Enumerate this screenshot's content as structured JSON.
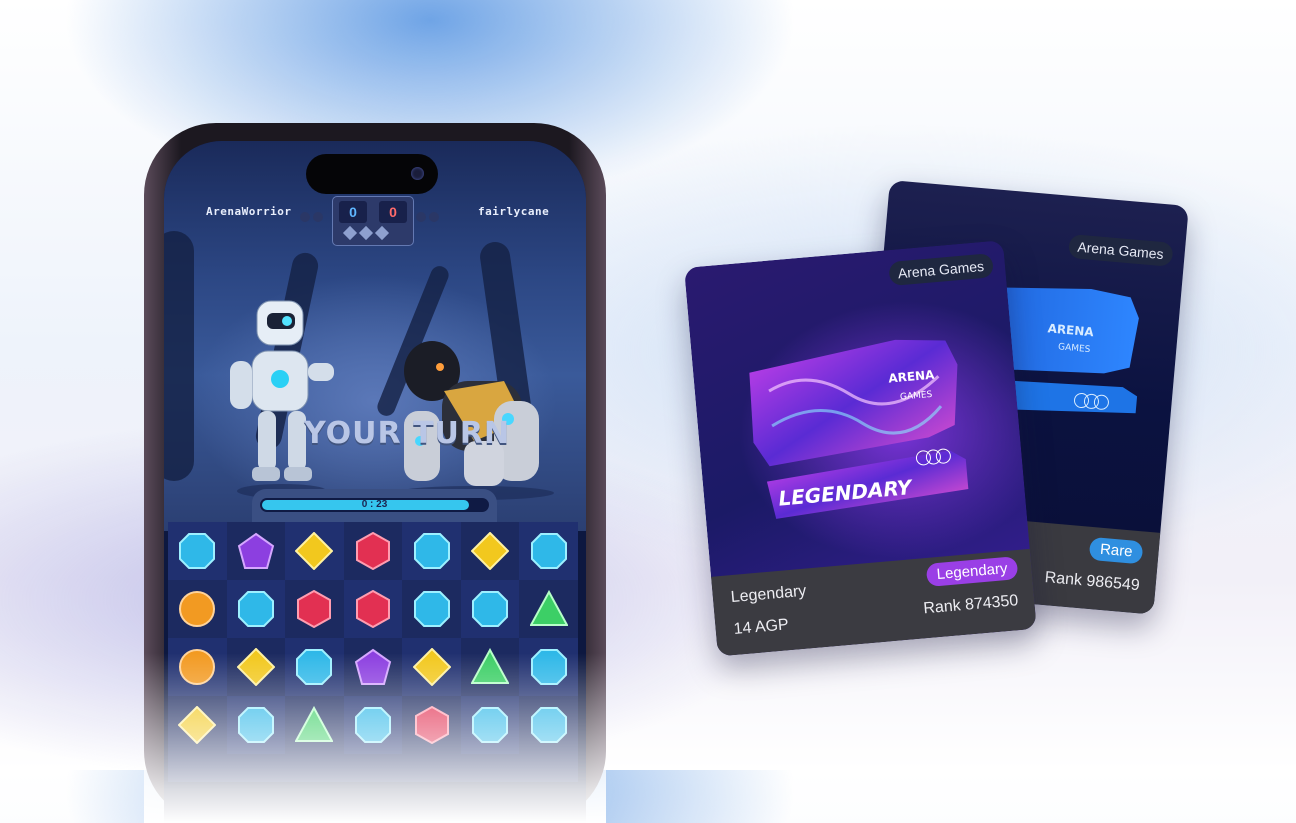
{
  "game": {
    "player_left": "ArenaWorrior",
    "player_right": "fairlycane",
    "score_left": "0",
    "score_right": "0",
    "turn_text": "YOUR TURN",
    "timer": "0 : 23",
    "timer_progress": 0.92,
    "colors": {
      "score_left": "#5fb6ff",
      "score_right": "#ff6b6b",
      "timer_fill": "#36c6ee"
    },
    "board": [
      [
        "blue",
        "purple",
        "yellow",
        "red",
        "blue",
        "yellow",
        "blue"
      ],
      [
        "orange",
        "blue",
        "red",
        "red",
        "blue",
        "blue",
        "green"
      ],
      [
        "orange",
        "yellow",
        "blue",
        "purple",
        "yellow",
        "green",
        "blue"
      ],
      [
        "yellow",
        "blue",
        "green",
        "blue",
        "red",
        "blue",
        "blue"
      ]
    ]
  },
  "card_back": {
    "brand": "Arena Games",
    "rarity_pill": "Rare",
    "rank": "Rank 986549",
    "pill_color": "#2f8fe0"
  },
  "card_front": {
    "brand": "Arena Games",
    "name": "Legendary",
    "rarity_pill": "Legendary",
    "price": "14 AGP",
    "rank": "Rank 874350",
    "pill_color": "#9a3fe6",
    "art_word": "LEGENDARY",
    "art_logo": "ARENA",
    "art_logo_sub": "GAMES"
  },
  "back_art": {
    "logo": "ARENA",
    "logo_sub": "GAMES"
  }
}
